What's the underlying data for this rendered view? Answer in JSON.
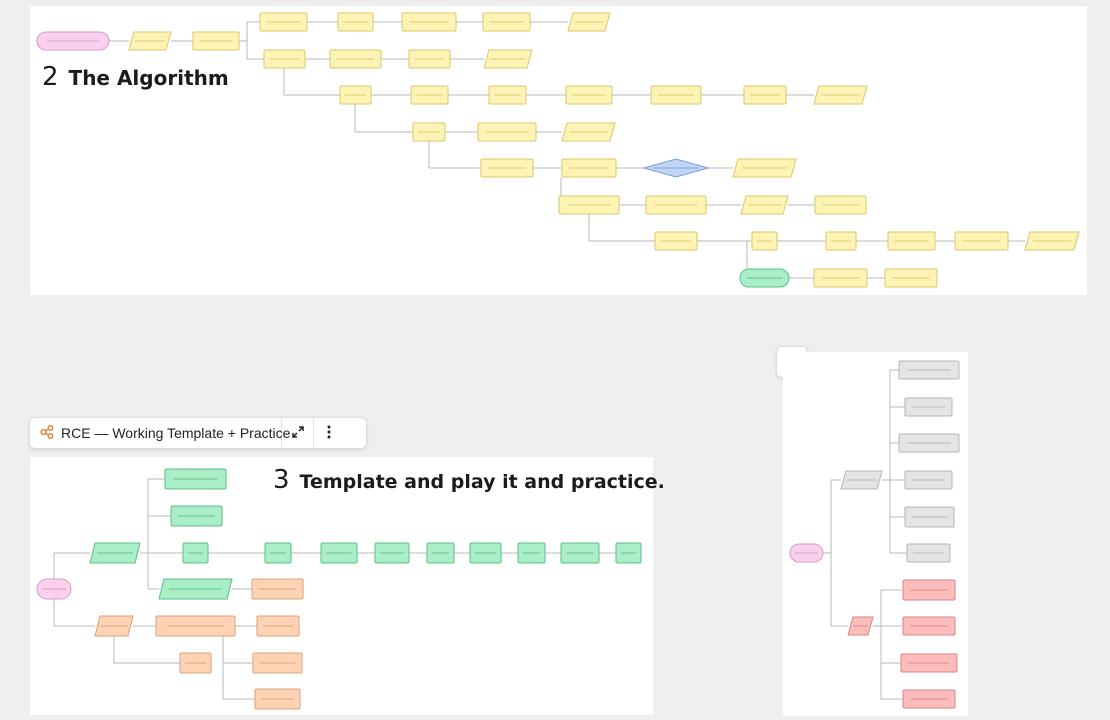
{
  "section_algorithm": {
    "number": "2",
    "title": "The Algorithm"
  },
  "section_template": {
    "number": "3",
    "title": "Template and play it and practice."
  },
  "frame_toolbar": {
    "title": "RCE — Working Template + Practice",
    "icon": "mindmap-icon",
    "expand_icon": "expand-icon",
    "more_icon": "more-vertical-icon"
  },
  "side_frame": {
    "icon": "mindmap-icon"
  },
  "colors": {
    "yellow_fill": "#fdf3b4",
    "yellow_stroke": "#d9c86a",
    "green_fill": "#a9eec6",
    "green_stroke": "#5bbf86",
    "pink_fill": "#fbd0ef",
    "pink_stroke": "#d69ac7",
    "blue_fill": "#bfd6f6",
    "blue_stroke": "#7b9ed6",
    "orange_fill": "#fdd3b4",
    "orange_stroke": "#d9a07a",
    "gray_fill": "#e4e4e4",
    "gray_stroke": "#b5b5b5",
    "red_fill": "#fdbcbc",
    "red_stroke": "#d88585",
    "accent_icon": "#e0833a"
  }
}
